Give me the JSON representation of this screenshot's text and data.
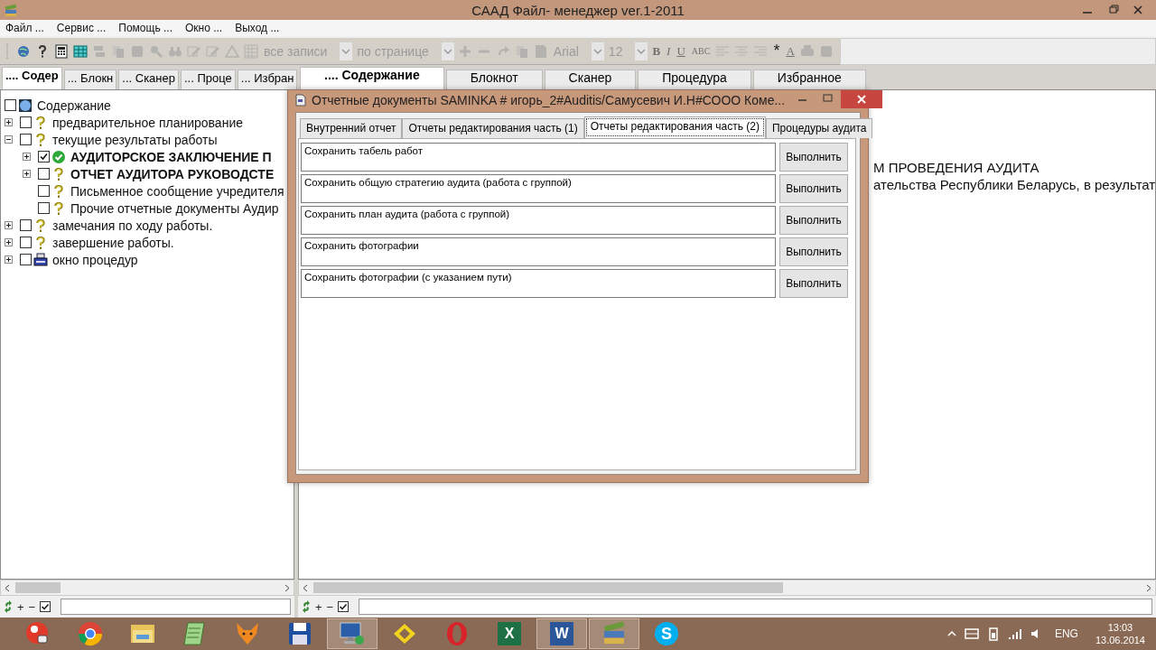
{
  "window": {
    "title": "СААД Файл- менеджер ver.1-2011"
  },
  "menu": [
    {
      "label": "Файл ..."
    },
    {
      "label": "Сервис ..."
    },
    {
      "label": "Помощь ..."
    },
    {
      "label": "Окно ..."
    },
    {
      "label": "Выход ..."
    }
  ],
  "toolbar": [
    {
      "kind": "globe",
      "disabled": false
    },
    {
      "kind": "help",
      "disabled": false
    },
    {
      "kind": "calculator",
      "disabled": false
    },
    {
      "kind": "table",
      "disabled": false
    },
    {
      "kind": "stack",
      "disabled": true
    },
    {
      "kind": "copy",
      "disabled": true
    },
    {
      "kind": "square",
      "disabled": true
    },
    {
      "kind": "magnifier",
      "disabled": true
    },
    {
      "kind": "binoculars",
      "disabled": true
    },
    {
      "kind": "pencil",
      "disabled": true
    },
    {
      "kind": "pencil",
      "disabled": true
    },
    {
      "kind": "triangle",
      "disabled": true
    },
    {
      "kind": "grid",
      "disabled": true
    },
    {
      "kind": "combo",
      "text": "все записи",
      "disabled": true
    },
    {
      "kind": "combo",
      "text": "по странице",
      "disabled": true
    },
    {
      "kind": "plus",
      "disabled": true
    },
    {
      "kind": "minus",
      "disabled": true
    },
    {
      "kind": "redo",
      "disabled": true
    },
    {
      "kind": "copy",
      "disabled": true
    },
    {
      "kind": "page",
      "disabled": true
    },
    {
      "kind": "combo",
      "text": "Arial",
      "disabled": true
    },
    {
      "kind": "combo",
      "text": "12",
      "disabled": true
    },
    {
      "kind": "bold",
      "label": "B",
      "disabled": true
    },
    {
      "kind": "italic",
      "label": "I",
      "disabled": true
    },
    {
      "kind": "underline",
      "label": "U",
      "disabled": true
    },
    {
      "kind": "small",
      "label": "ABC",
      "disabled": true
    },
    {
      "kind": "align-left",
      "disabled": true
    },
    {
      "kind": "align-center",
      "disabled": true
    },
    {
      "kind": "align-right",
      "disabled": true
    },
    {
      "kind": "plain",
      "label": "*",
      "disabled": false
    },
    {
      "kind": "underline",
      "label": "A",
      "disabled": true
    },
    {
      "kind": "printer",
      "disabled": true
    },
    {
      "kind": "square",
      "disabled": true
    }
  ],
  "left_pane": {
    "tabs": [
      {
        "label": ".... Содер",
        "selected": true
      },
      {
        "label": "... Блокн",
        "selected": false
      },
      {
        "label": "... Сканер",
        "selected": false
      },
      {
        "label": "... Проце",
        "selected": false
      },
      {
        "label": "... Избран",
        "selected": false
      }
    ],
    "tree": [
      {
        "label": "Содержание",
        "kind": "globe",
        "checked": false,
        "bold": false,
        "children": [
          {
            "label": "предварительное планирование",
            "kind": "help",
            "checked": false,
            "bold": false,
            "expanded": false
          },
          {
            "label": "текущие результаты работы",
            "kind": "help",
            "checked": false,
            "bold": false,
            "expanded": true,
            "children": [
              {
                "label": "АУДИТОРСКОЕ ЗАКЛЮЧЕНИЕ П",
                "kind": "check",
                "checked": true,
                "bold": true,
                "expanded": false
              },
              {
                "label": "ОТЧЕТ АУДИТОРА РУКОВОДСТЕ",
                "kind": "help",
                "checked": false,
                "bold": true,
                "expanded": false
              },
              {
                "label": "Письменное сообщение учредителя",
                "kind": "help",
                "checked": false,
                "bold": false
              },
              {
                "label": "Прочие отчетные документы Аудир",
                "kind": "help",
                "checked": false,
                "bold": false
              }
            ]
          },
          {
            "label": "замечания по ходу работы.",
            "kind": "help",
            "checked": false,
            "bold": false,
            "expanded": false
          },
          {
            "label": "завершение работы.",
            "kind": "help",
            "checked": false,
            "bold": false,
            "expanded": false
          },
          {
            "label": "окно процедур",
            "kind": "machine",
            "checked": false,
            "bold": false,
            "expanded": false
          }
        ]
      }
    ]
  },
  "right_pane": {
    "tabs": [
      {
        "label": ".... Содержание",
        "selected": true
      },
      {
        "label": "Блокнот",
        "selected": false
      },
      {
        "label": "Сканер",
        "selected": false
      },
      {
        "label": "Процедура",
        "selected": false
      },
      {
        "label": "Избранное",
        "selected": false
      }
    ],
    "lines": [
      {
        "text": "М ПРОВЕДЕНИЯ АУДИТА"
      },
      {
        "text": "ательства Республики Беларусь, в результат"
      }
    ]
  },
  "bottom_bars": [
    {
      "plus": "+",
      "minus": "−",
      "checked": true
    },
    {
      "plus": "+",
      "minus": "−",
      "checked": true
    }
  ],
  "dialog": {
    "title": "Отчетные документы SAMINKA # игорь_2#Auditis/Самусевич И.Н#СООО Коме...",
    "tabs": [
      {
        "label": "Внутренний отчет",
        "selected": false
      },
      {
        "label": "Отчеты редактирования часть (1)",
        "selected": false
      },
      {
        "label": "Отчеты редактирования часть (2)",
        "selected": true
      },
      {
        "label": "Процедуры аудита",
        "selected": false
      }
    ],
    "rows": [
      {
        "text": "Сохранить табель работ",
        "button": "Выполнить"
      },
      {
        "text": "Сохранить общую стратегию аудита (работа с группой)",
        "button": "Выполнить"
      },
      {
        "text": "Сохранить план аудита (работа с группой)",
        "button": "Выполнить"
      },
      {
        "text": "Сохранить фотографии",
        "button": "Выполнить"
      },
      {
        "text": "Сохранить фотографии (с указанием пути)",
        "button": "Выполнить"
      }
    ]
  },
  "taskbar": {
    "apps": [
      {
        "kind": "paint",
        "active": false
      },
      {
        "kind": "chrome",
        "active": false
      },
      {
        "kind": "folder",
        "active": false
      },
      {
        "kind": "notepad",
        "active": false
      },
      {
        "kind": "fox",
        "active": false
      },
      {
        "kind": "floppy",
        "active": false
      },
      {
        "kind": "monitor",
        "active": true
      },
      {
        "kind": "diamond",
        "active": false
      },
      {
        "kind": "opera",
        "active": false
      },
      {
        "kind": "excel",
        "label": "X",
        "active": false
      },
      {
        "kind": "word",
        "label": "W",
        "active": true
      },
      {
        "kind": "books",
        "active": true
      },
      {
        "kind": "skype",
        "label": "S",
        "active": false
      }
    ],
    "language": "ENG",
    "time": "13:03",
    "date": "13.06.2014"
  }
}
